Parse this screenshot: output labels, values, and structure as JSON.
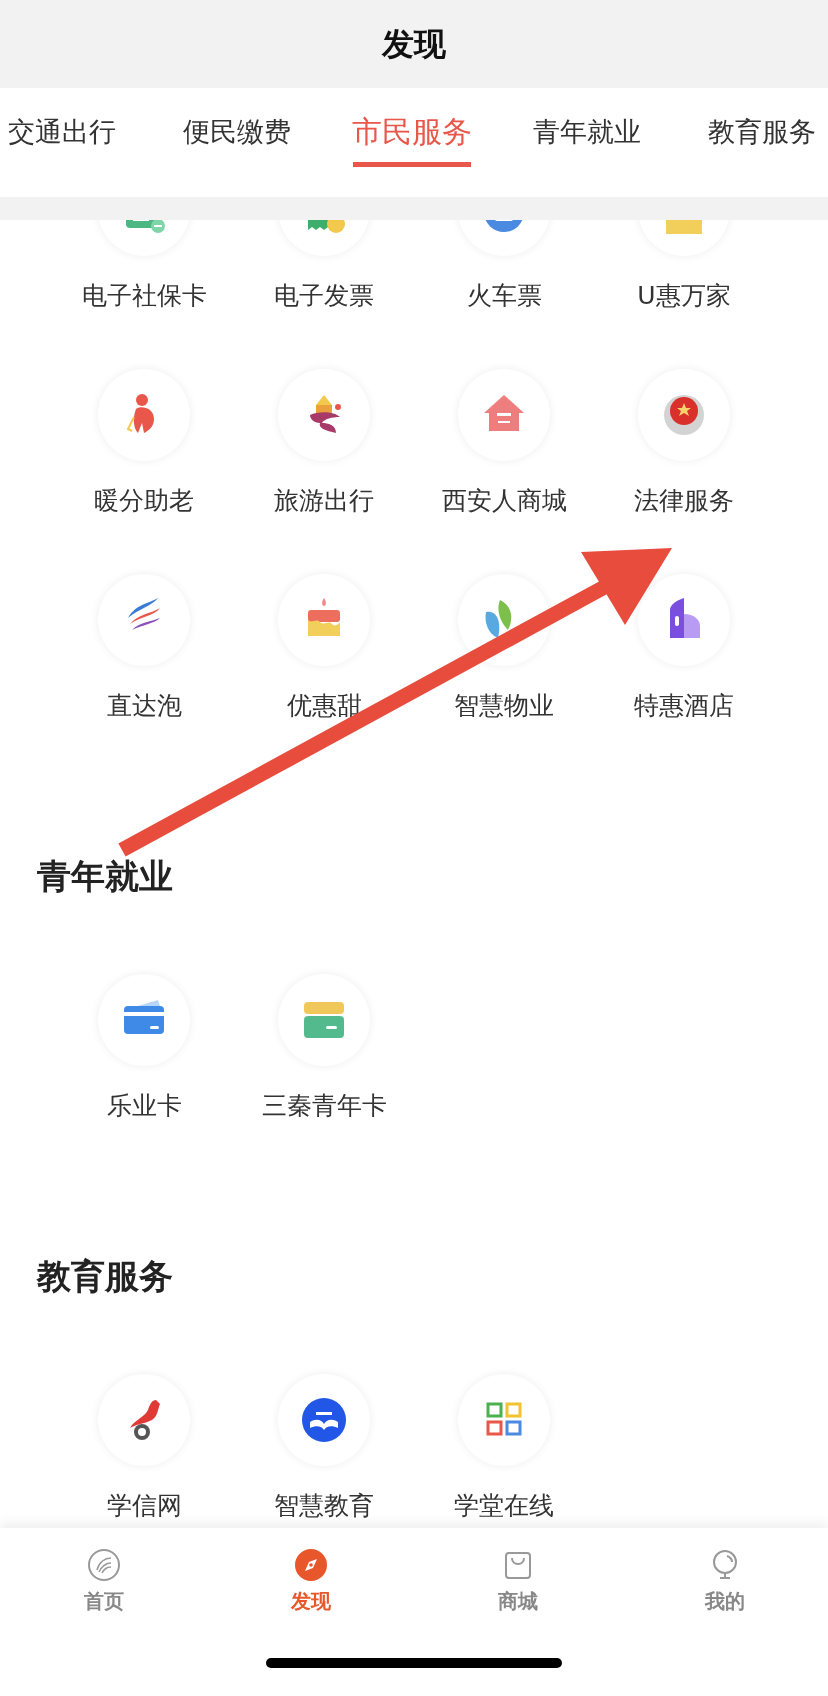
{
  "header": {
    "title": "发现"
  },
  "tabs": [
    {
      "label": "交通出行",
      "selected": false
    },
    {
      "label": "便民缴费",
      "selected": false
    },
    {
      "label": "市民服务",
      "selected": true
    },
    {
      "label": "青年就业",
      "selected": false
    },
    {
      "label": "教育服务",
      "selected": false
    }
  ],
  "sections": [
    {
      "items": [
        "电子社保卡",
        "电子发票",
        "火车票",
        "U惠万家",
        "暖分助老",
        "旅游出行",
        "西安人商城",
        "法律服务",
        "直达泡",
        "优惠甜",
        "智慧物业",
        "特惠酒店"
      ]
    },
    {
      "title": "青年就业",
      "items": [
        "乐业卡",
        "三秦青年卡"
      ]
    },
    {
      "title": "教育服务",
      "items": [
        "学信网",
        "智慧教育",
        "学堂在线"
      ]
    }
  ],
  "bottom_nav": [
    {
      "label": "首页",
      "selected": false
    },
    {
      "label": "发现",
      "selected": true
    },
    {
      "label": "商城",
      "selected": false
    },
    {
      "label": "我的",
      "selected": false
    }
  ]
}
